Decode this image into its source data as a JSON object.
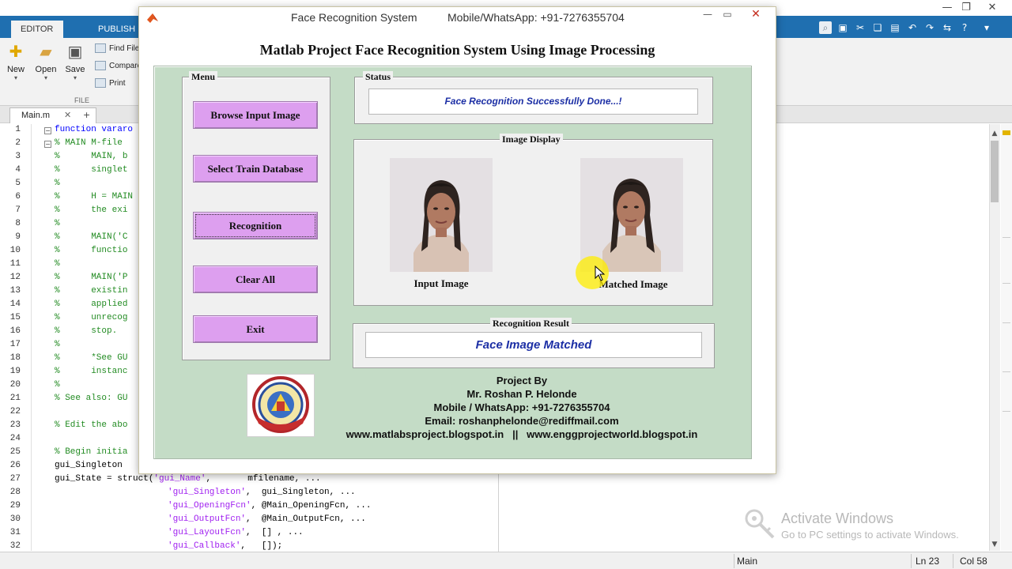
{
  "matlab": {
    "ribbon_tabs": [
      "EDITOR",
      "PUBLISH"
    ],
    "ribbon_buttons": [
      {
        "label": "New",
        "icon": "plus-icon"
      },
      {
        "label": "Open",
        "icon": "folder-icon"
      },
      {
        "label": "Save",
        "icon": "save-icon"
      }
    ],
    "ribbon_small": [
      "Find Files",
      "Compare",
      "Print"
    ],
    "ribbon_section": "FILE",
    "editor_tab": {
      "name": "Main.m",
      "close": "✕",
      "add": "+"
    },
    "line_numbers": [
      "1",
      "2",
      "3",
      "4",
      "5",
      "6",
      "7",
      "8",
      "9",
      "10",
      "11",
      "12",
      "13",
      "14",
      "15",
      "16",
      "17",
      "18",
      "19",
      "20",
      "21",
      "22",
      "23",
      "24",
      "25",
      "26",
      "27",
      "28",
      "29",
      "30",
      "31",
      "32"
    ],
    "code": {
      "l1": "function vararo",
      "l2": "% MAIN M-file",
      "l3": "%      MAIN, b",
      "l4": "%      singlet",
      "l5": "%",
      "l6": "%      H = MAIN",
      "l7": "%      the exi",
      "l8": "%",
      "l9": "%      MAIN('C",
      "l10": "%      functio",
      "l11": "%",
      "l12": "%      MAIN('P",
      "l13": "%      existin",
      "l14": "%      applied",
      "l15": "%      unrecog",
      "l16": "%      stop.",
      "l17": "%",
      "l18": "%      *See GU",
      "l19": "%      instanc",
      "l20": "%",
      "l21": "% See also: GU",
      "l22": "",
      "l23": "% Edit the abo",
      "l24": "",
      "l25": "% Begin initia",
      "l26a": "gui_Singleton ",
      "l27a": "gui_State = struct(",
      "l27s": "'gui_Name'",
      "l27b": ",       mfilename, ...",
      "l28s": "'gui_Singleton'",
      "l28b": ",  gui_Singleton, ...",
      "l29s": "'gui_OpeningFcn'",
      "l29b": ", @Main_OpeningFcn, ...",
      "l30s": "'gui_OutputFcn'",
      "l30b": ",  @Main_OutputFcn, ...",
      "l31s": "'gui_LayoutFcn'",
      "l31b": ",  [] , ...",
      "l32s": "'gui_Callback'",
      "l32b": ",   []);"
    },
    "status": {
      "main": "Main",
      "ln": "Ln  23",
      "col": "Col  58"
    },
    "activate": {
      "title": "Activate Windows",
      "subtitle": "Go to PC settings to activate Windows."
    }
  },
  "figure": {
    "title": "Face Recognition System",
    "title_contact": "Mobile/WhatsApp: +91-7276355704",
    "heading": "Matlab Project Face Recognition System Using Image Processing",
    "menu": {
      "title": "Menu",
      "buttons": [
        "Browse Input Image",
        "Select Train Database",
        "Recognition",
        "Clear All",
        "Exit"
      ]
    },
    "status": {
      "title": "Status",
      "message": "Face Recognition Successfully Done...!"
    },
    "image_display": {
      "title": "Image Display",
      "input_label": "Input Image",
      "matched_label": "Matched Image"
    },
    "result": {
      "title": "Recognition Result",
      "message": "Face Image Matched"
    },
    "credits": [
      "Project By",
      "Mr. Roshan P. Helonde",
      "Mobile / WhatsApp: +91-7276355704",
      "Email: roshanphelonde@rediffmail.com",
      "www.matlabsproject.blogspot.in   ||   www.enggprojectworld.blogspot.in"
    ]
  },
  "colors": {
    "button": "#dd9fef",
    "panel": "#c4dcc6",
    "status_text": "#1c2fa5",
    "matlab_blue": "#1f6fb0"
  }
}
